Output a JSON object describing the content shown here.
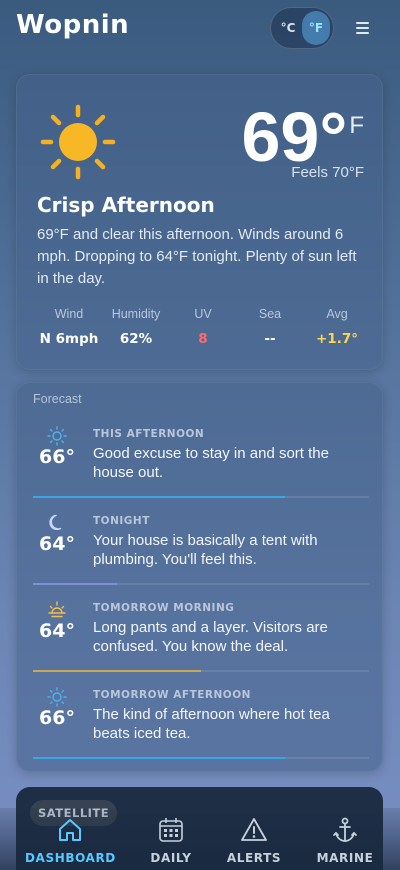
{
  "app": {
    "logo": "Wopnin"
  },
  "header": {
    "unit_c": "°C",
    "unit_f": "°F",
    "active_unit": "°F"
  },
  "current": {
    "temp": "69°",
    "temp_unit": "F",
    "feels_like": "Feels 70°F",
    "title": "Crisp Afternoon",
    "description": "69°F and clear this afternoon. Winds around 6 mph. Dropping to 64°F tonight. Plenty of sun left in the day.",
    "stats": [
      {
        "label": "Wind",
        "value": "N 6mph",
        "color": "#ffffff"
      },
      {
        "label": "Humidity",
        "value": "62%",
        "color": "#ffffff"
      },
      {
        "label": "UV",
        "value": "8",
        "color": "#ff6b6b"
      },
      {
        "label": "Sea",
        "value": "--",
        "color": "#ffffff"
      },
      {
        "label": "Avg",
        "value": "+1.7°",
        "color": "#ffd54a"
      }
    ]
  },
  "forecast": {
    "title": "Forecast",
    "items": [
      {
        "icon": "sun-icon",
        "temp": "66°",
        "label": "THIS AFTERNOON",
        "text": "Good excuse to stay in and sort the house out.",
        "bar_fraction": 0.75,
        "bar_color": "#3aa6e6"
      },
      {
        "icon": "moon-icon",
        "temp": "64°",
        "label": "TONIGHT",
        "text": "Your house is basically a tent with plumbing. You'll feel this.",
        "bar_fraction": 0.25,
        "bar_color": "#7f8fe0"
      },
      {
        "icon": "sunrise-icon",
        "temp": "64°",
        "label": "TOMORROW MORNING",
        "text": "Long pants and a layer. Visitors are confused. You know the deal.",
        "bar_fraction": 0.5,
        "bar_color": "#c9a84e"
      },
      {
        "icon": "sun-icon",
        "temp": "66°",
        "label": "TOMORROW AFTERNOON",
        "text": "The kind of afternoon where hot tea beats iced tea.",
        "bar_fraction": 0.75,
        "bar_color": "#3aa6e6"
      }
    ]
  },
  "satellite": {
    "label": "SATELLITE"
  },
  "tabs": [
    {
      "label": "DASHBOARD",
      "icon": "home-icon",
      "active": true
    },
    {
      "label": "DAILY",
      "icon": "calendar-icon",
      "active": false
    },
    {
      "label": "ALERTS",
      "icon": "alert-triangle-icon",
      "active": false
    },
    {
      "label": "MARINE",
      "icon": "anchor-icon",
      "active": false
    }
  ]
}
